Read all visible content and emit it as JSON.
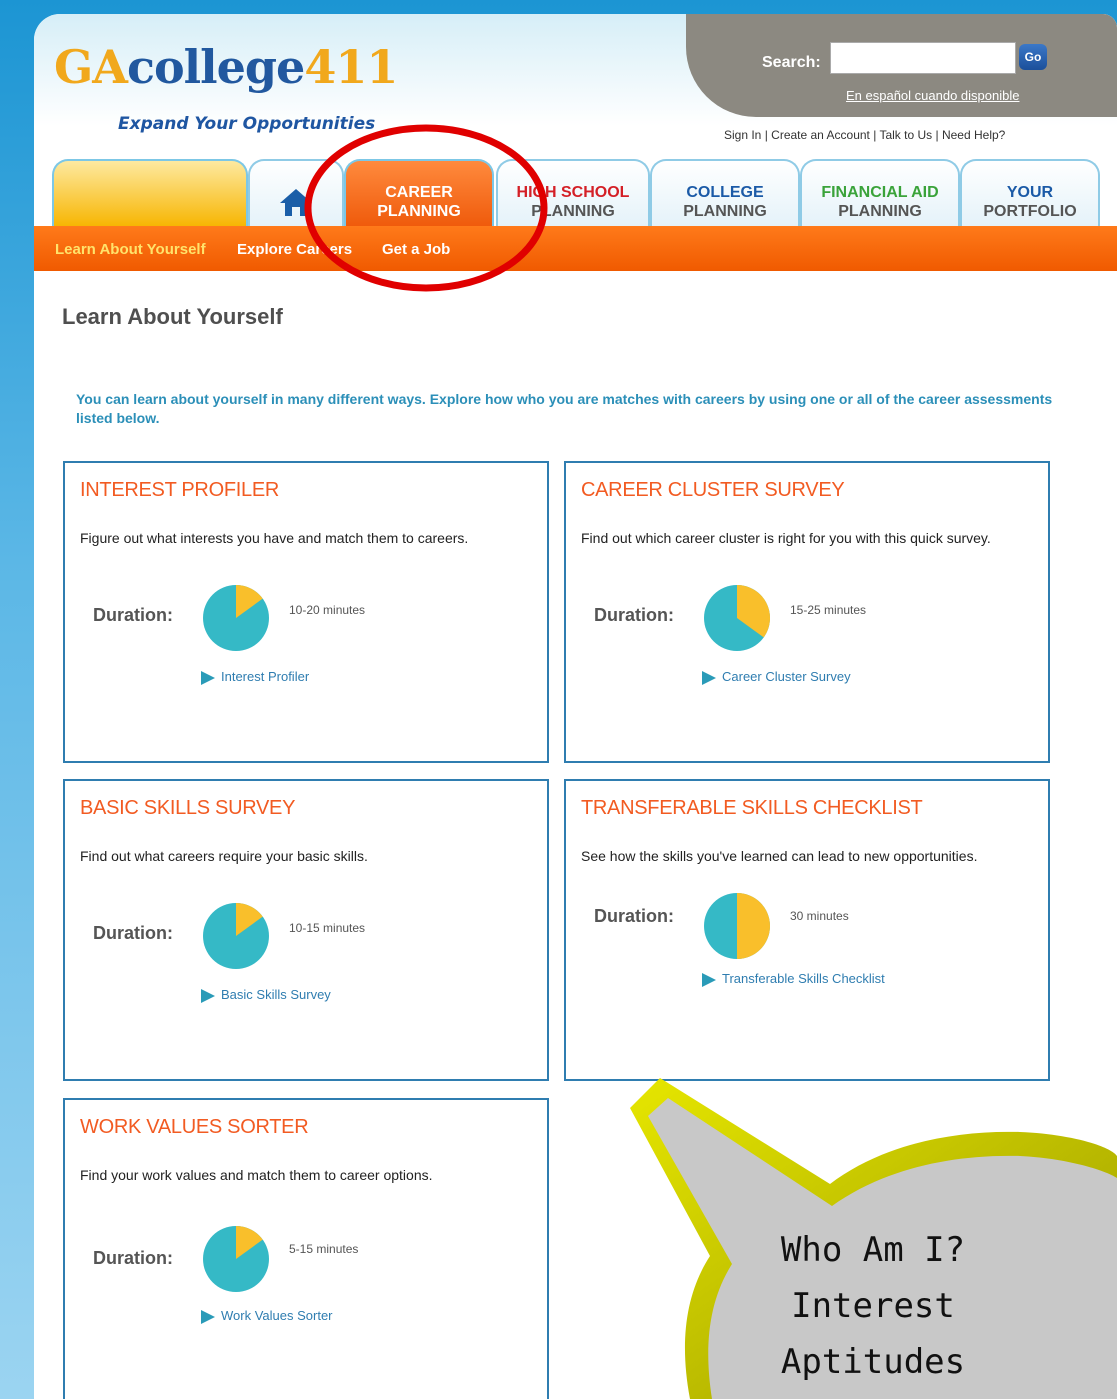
{
  "logo": {
    "ga": "GA",
    "college": "college",
    "num": "411"
  },
  "tagline": "Expand Your Opportunities",
  "search": {
    "label": "Search:",
    "placeholder": "",
    "go_label": "Go",
    "espanol": "En español cuando disponible"
  },
  "util_links": {
    "sign_in": "Sign In",
    "create": "Create an Account",
    "talk": "Talk to Us",
    "help": "Need Help?",
    "sep": " | "
  },
  "tabs": [
    {
      "line1": "",
      "line2": ""
    },
    {
      "icon": "home-icon"
    },
    {
      "line1": "CAREER",
      "line2": "PLANNING"
    },
    {
      "line1": "HIGH SCHOOL",
      "line2": "PLANNING"
    },
    {
      "line1": "COLLEGE",
      "line2": "PLANNING"
    },
    {
      "line1": "FINANCIAL AID",
      "line2": "PLANNING"
    },
    {
      "line1": "YOUR",
      "line2": "PORTFOLIO"
    }
  ],
  "subnav": {
    "learn": "Learn About Yourself",
    "explore": "Explore Careers",
    "job": "Get a Job"
  },
  "page_title": "Learn About Yourself",
  "intro": "You can learn about yourself in many different ways. Explore how who you are matches with careers by using one or all of the career assessments listed below.",
  "duration_label": "Duration:",
  "cards": [
    {
      "title": "INTEREST PROFILER",
      "desc": "Figure out what interests you have and match them to careers.",
      "time": "10-20 minutes",
      "link": "Interest Profiler",
      "fraction": 0.15
    },
    {
      "title": "CAREER CLUSTER SURVEY",
      "desc": "Find out which career cluster is right for you with this quick survey.",
      "time": "15-25 minutes",
      "link": "Career Cluster Survey",
      "fraction": 0.35
    },
    {
      "title": "BASIC SKILLS SURVEY",
      "desc": "Find out what careers require your basic skills.",
      "time": "10-15 minutes",
      "link": "Basic Skills Survey",
      "fraction": 0.15
    },
    {
      "title": "TRANSFERABLE SKILLS CHECKLIST",
      "desc": "See how the skills you've learned can lead to new opportunities.",
      "time": "30 minutes",
      "link": "Transferable Skills Checklist",
      "fraction": 0.5
    },
    {
      "title": "WORK VALUES SORTER",
      "desc": "Find your work values and match them to career options.",
      "time": "5-15 minutes",
      "link": "Work Values Sorter",
      "fraction": 0.15
    }
  ],
  "bubble": {
    "line1": "Who Am I?",
    "line2": "Interest",
    "line3": "Aptitudes"
  },
  "colors": {
    "brand_blue": "#21589f",
    "brand_gold": "#f1a81c",
    "orange": "#f05a00",
    "card_border": "#2f7db0",
    "pie_teal": "#35b9c6",
    "pie_gold": "#f9bf2b",
    "annotation_red": "#e00000"
  }
}
